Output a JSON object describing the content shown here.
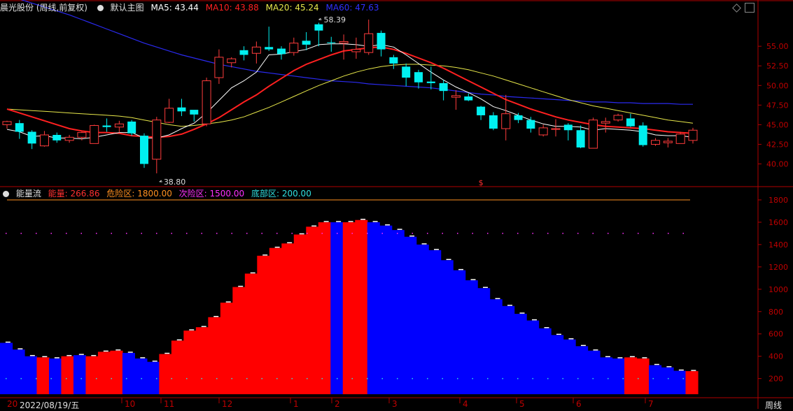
{
  "header_main": {
    "stock_name": "晨光股份 (周线,前复权)",
    "indicator": "默认主图",
    "ma5": "MA5: 43.44",
    "ma10": "MA10: 43.88",
    "ma20": "MA20: 45.24",
    "ma60": "MA60: 47.63"
  },
  "header_sub": {
    "indicator": "能量流",
    "energy": "能量: 266.86",
    "danger": "危险区: 1800.00",
    "second": "次险区: 1500.00",
    "bottom": "底部区: 200.00"
  },
  "colors": {
    "ma5": "#ffffff",
    "ma10": "#ff2020",
    "ma20": "#e8e84a",
    "ma60": "#2a2af0",
    "up": "#ff3c3c",
    "down": "#00f0f0",
    "axis": "#b00000",
    "energy_red": "#ff0000",
    "energy_blue": "#0000ff"
  },
  "date_axis": {
    "first": "20",
    "date": "2022/08/19/五",
    "months": [
      "10",
      "11",
      "12",
      "1",
      "2",
      "3",
      "4",
      "5",
      "6",
      "7"
    ],
    "period": "周线"
  },
  "chart_data": [
    {
      "type": "candlestick",
      "ylim": [
        38,
        58.4
      ],
      "yticks": [
        "55.00",
        "52.50",
        "50.00",
        "47.50",
        "45.00",
        "42.50",
        "40.00"
      ],
      "annotations": [
        "58.39",
        "38.80",
        "$"
      ],
      "candles": [
        [
          45.0,
          45.4,
          44.5,
          45.5
        ],
        [
          45.2,
          44.1,
          43.2,
          45.6
        ],
        [
          44.1,
          42.6,
          41.9,
          44.3
        ],
        [
          42.3,
          43.7,
          42.2,
          44.2
        ],
        [
          43.7,
          43.0,
          42.7,
          44.0
        ],
        [
          43.0,
          43.4,
          42.7,
          43.7
        ],
        [
          43.4,
          44.0,
          43.0,
          44.1
        ],
        [
          42.6,
          44.9,
          42.6,
          45.0
        ],
        [
          44.9,
          44.7,
          44.1,
          45.8
        ],
        [
          44.7,
          45.1,
          44.0,
          45.5
        ],
        [
          45.4,
          43.9,
          43.6,
          45.6
        ],
        [
          43.6,
          40.0,
          39.5,
          43.9
        ],
        [
          40.6,
          45.6,
          38.8,
          46.0
        ],
        [
          45.3,
          47.1,
          45.2,
          48.3
        ],
        [
          47.2,
          46.7,
          46.1,
          48.3
        ],
        [
          46.9,
          46.3,
          45.4,
          46.6
        ],
        [
          45.1,
          50.6,
          44.8,
          51.0
        ],
        [
          51.0,
          53.6,
          50.2,
          54.6
        ],
        [
          52.9,
          53.4,
          52.3,
          53.6
        ],
        [
          54.5,
          53.9,
          53.2,
          55.0
        ],
        [
          54.1,
          54.9,
          52.8,
          55.6
        ],
        [
          54.9,
          54.6,
          54.4,
          57.5
        ],
        [
          54.7,
          54.0,
          53.3,
          55.0
        ],
        [
          54.2,
          55.4,
          53.8,
          56.1
        ],
        [
          55.7,
          55.2,
          54.5,
          56.8
        ],
        [
          57.8,
          57.0,
          55.0,
          58.0
        ],
        [
          55.5,
          55.4,
          54.3,
          56.2
        ],
        [
          55.4,
          55.6,
          53.3,
          56.5
        ],
        [
          54.3,
          54.6,
          53.4,
          56.1
        ],
        [
          54.2,
          56.6,
          53.9,
          58.4
        ],
        [
          56.7,
          54.6,
          53.7,
          57.0
        ],
        [
          53.6,
          52.8,
          52.1,
          53.9
        ],
        [
          52.4,
          51.0,
          49.9,
          52.8
        ],
        [
          51.7,
          50.4,
          49.6,
          52.0
        ],
        [
          50.5,
          50.3,
          49.5,
          52.4
        ],
        [
          50.3,
          49.3,
          48.1,
          50.7
        ],
        [
          48.5,
          48.7,
          46.9,
          49.4
        ],
        [
          48.6,
          48.1,
          48.0,
          49.0
        ],
        [
          47.3,
          46.2,
          45.6,
          47.4
        ],
        [
          46.2,
          44.5,
          44.3,
          46.6
        ],
        [
          44.5,
          46.4,
          43.0,
          48.8
        ],
        [
          46.2,
          45.6,
          45.2,
          46.5
        ],
        [
          45.6,
          44.5,
          44.0,
          46.0
        ],
        [
          43.7,
          44.6,
          43.5,
          45.0
        ],
        [
          44.4,
          44.5,
          43.5,
          45.7
        ],
        [
          45.0,
          44.3,
          43.0,
          45.2
        ],
        [
          44.3,
          42.1,
          42.0,
          44.9
        ],
        [
          42.0,
          45.6,
          42.0,
          45.9
        ],
        [
          45.2,
          45.4,
          44.0,
          45.9
        ],
        [
          45.6,
          46.2,
          45.4,
          46.4
        ],
        [
          45.8,
          44.8,
          44.7,
          46.4
        ],
        [
          44.9,
          42.4,
          42.2,
          45.3
        ],
        [
          42.5,
          43.0,
          42.3,
          43.3
        ],
        [
          42.7,
          42.9,
          42.1,
          43.3
        ],
        [
          42.6,
          43.8,
          42.6,
          44.1
        ],
        [
          43.0,
          44.3,
          42.6,
          44.6
        ]
      ],
      "ma5": [
        44.4,
        44.1,
        43.5,
        43.6,
        43.3,
        43.3,
        43.2,
        43.4,
        43.7,
        44.0,
        44.0,
        43.3,
        43.3,
        43.7,
        44.5,
        45.2,
        46.5,
        48.1,
        49.7,
        50.6,
        51.7,
        53.9,
        54.0,
        54.3,
        54.6,
        55.2,
        55.3,
        55.3,
        55.2,
        55.0,
        55.2,
        54.9,
        53.9,
        52.8,
        51.7,
        50.7,
        49.8,
        49.1,
        48.3,
        47.3,
        46.8,
        46.2,
        45.6,
        45.1,
        44.8,
        44.8,
        44.7,
        44.3,
        44.5,
        44.4,
        44.3,
        44.1,
        43.7,
        43.6,
        43.6,
        43.4
      ],
      "ma10": [
        47.0,
        46.5,
        46.0,
        45.5,
        45.0,
        44.5,
        44.2,
        44.0,
        44.0,
        43.9,
        43.6,
        43.5,
        43.4,
        43.5,
        43.8,
        44.4,
        45.1,
        45.9,
        46.9,
        47.9,
        48.8,
        49.9,
        50.9,
        51.9,
        52.7,
        53.3,
        53.9,
        54.4,
        54.6,
        54.8,
        54.9,
        54.6,
        54.1,
        53.5,
        52.9,
        52.2,
        51.4,
        50.6,
        49.8,
        49.0,
        48.2,
        47.6,
        47.0,
        46.5,
        46.0,
        45.6,
        45.3,
        45.0,
        44.8,
        44.7,
        44.6,
        44.5,
        44.3,
        44.1,
        44.0,
        43.9
      ],
      "ma20": [
        47.0,
        46.9,
        46.8,
        46.7,
        46.6,
        46.5,
        46.4,
        46.3,
        46.2,
        46.1,
        45.9,
        45.6,
        45.3,
        45.0,
        44.8,
        44.9,
        45.1,
        45.3,
        45.6,
        46.0,
        46.6,
        47.2,
        47.9,
        48.6,
        49.3,
        50.0,
        50.6,
        51.2,
        51.7,
        52.1,
        52.4,
        52.6,
        52.7,
        52.7,
        52.6,
        52.5,
        52.3,
        52.0,
        51.6,
        51.2,
        50.7,
        50.2,
        49.7,
        49.2,
        48.7,
        48.2,
        47.8,
        47.4,
        47.1,
        46.8,
        46.5,
        46.2,
        45.9,
        45.6,
        45.4,
        45.2
      ],
      "ma60": [
        61.5,
        61.0,
        60.5,
        60.0,
        59.5,
        59.0,
        58.4,
        57.8,
        57.2,
        56.6,
        56.0,
        55.4,
        54.9,
        54.4,
        53.9,
        53.5,
        53.1,
        52.7,
        52.4,
        52.1,
        51.8,
        51.6,
        51.4,
        51.2,
        51.0,
        50.8,
        50.6,
        50.5,
        50.4,
        50.2,
        50.1,
        50.0,
        49.9,
        49.8,
        49.7,
        49.5,
        49.3,
        49.1,
        48.9,
        48.8,
        48.6,
        48.5,
        48.4,
        48.3,
        48.2,
        48.1,
        48.0,
        47.9,
        47.9,
        47.8,
        47.8,
        47.7,
        47.7,
        47.7,
        47.6,
        47.6
      ]
    },
    {
      "type": "bar",
      "ylim": [
        0,
        1950
      ],
      "yticks": [
        "1800",
        "1600",
        "1400",
        "1200",
        "1000",
        "800",
        "600",
        "400",
        "200"
      ],
      "danger": 1800,
      "second": 1500,
      "bottom": 200,
      "values": [
        520,
        460,
        400,
        390,
        380,
        400,
        410,
        400,
        440,
        450,
        430,
        380,
        350,
        420,
        540,
        630,
        660,
        750,
        880,
        1020,
        1140,
        1300,
        1370,
        1410,
        1490,
        1560,
        1600,
        1600,
        1600,
        1620,
        1600,
        1570,
        1530,
        1470,
        1400,
        1350,
        1260,
        1170,
        1080,
        1010,
        910,
        850,
        780,
        720,
        650,
        590,
        550,
        490,
        450,
        390,
        380,
        390,
        380,
        320,
        300,
        270,
        266.86
      ],
      "colors": [
        "b",
        "b",
        "b",
        "r",
        "b",
        "r",
        "b",
        "r",
        "r",
        "r",
        "b",
        "b",
        "b",
        "r",
        "r",
        "r",
        "r",
        "r",
        "r",
        "r",
        "r",
        "r",
        "r",
        "r",
        "r",
        "r",
        "r",
        "b",
        "r",
        "r",
        "b",
        "b",
        "b",
        "b",
        "b",
        "b",
        "b",
        "b",
        "b",
        "b",
        "b",
        "b",
        "b",
        "b",
        "b",
        "b",
        "b",
        "b",
        "b",
        "b",
        "b",
        "r",
        "r",
        "b",
        "b",
        "b",
        "r"
      ]
    }
  ]
}
